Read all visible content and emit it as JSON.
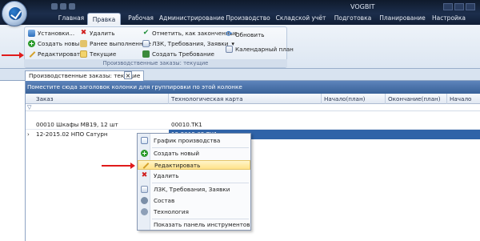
{
  "app": {
    "title": "VOGBIT"
  },
  "menu": {
    "items": [
      "Главная",
      "Правка",
      "Рабочая",
      "Администрирование",
      "Производство",
      "Складской учёт",
      "Подготовка",
      "Планирование",
      "Настройка"
    ],
    "active": "Правка"
  },
  "ribbon": {
    "settings": "Установки...",
    "create_new": "Создать новый",
    "edit": "Редактировать",
    "delete": "Удалить",
    "done_before": "Ранее выполненные",
    "current": "Текущие",
    "mark_finished": "Отметить, как законченные",
    "lzk": "ЛЗК, Требования, Заявки",
    "create_request": "Создать Требование",
    "refresh": "Обновить",
    "calendar": "Календарный план",
    "group_caption": "Производственные заказы: текущие"
  },
  "document_tab": {
    "label": "Производственные заказы: текущие",
    "close": "×"
  },
  "grid": {
    "group_panel_hint": "Поместите сюда заголовок колонки для группировки по этой колонке",
    "columns": [
      "Заказ",
      "Технологическая карта",
      "Начало(план)",
      "Окончание(план)",
      "Начало"
    ],
    "rows": [
      {
        "order": "00010 Шкафы МВ19, 12 шт",
        "techcard": "00010.TK1"
      },
      {
        "order": "12-2015.02 НПО Сатурн",
        "techcard": "12-2015.02.ТК1"
      }
    ]
  },
  "context_menu": {
    "items": [
      {
        "label": "График производства",
        "icon": "chart-icon"
      },
      {
        "label": "Создать новый",
        "icon": "add-icon"
      },
      {
        "label": "Редактировать",
        "icon": "edit-icon",
        "highlighted": true
      },
      {
        "label": "Удалить",
        "icon": "delete-icon"
      },
      {
        "label": "ЛЗК, Требования, Заявки",
        "icon": "documents-icon"
      },
      {
        "label": "Состав",
        "icon": "gear-icon"
      },
      {
        "label": "Технология",
        "icon": "technology-icon"
      },
      {
        "label": "Показать панель инструментов",
        "icon": ""
      }
    ]
  },
  "colors": {
    "annotation_arrow": "#e01b1b",
    "selection": "#2f63a8",
    "highlight": "#ffe28a"
  }
}
